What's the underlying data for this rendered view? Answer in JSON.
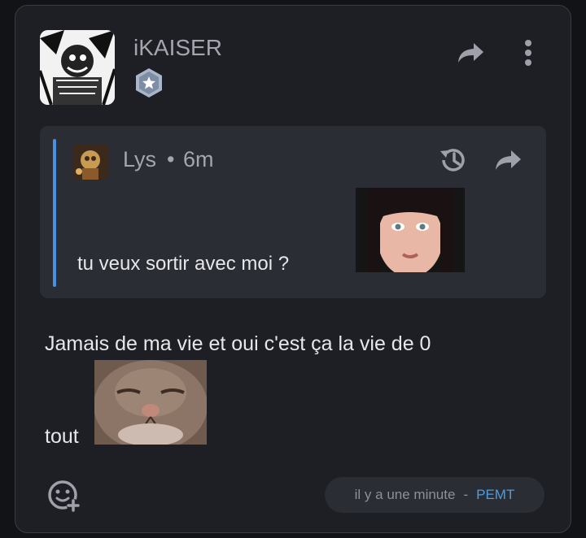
{
  "post": {
    "author": "iKAISER",
    "avatar_icon": "manga-avatar",
    "badge_icon": "star-badge-icon"
  },
  "quote": {
    "author": "Lys",
    "separator": "•",
    "time": "6m",
    "text": "tu veux sortir avec moi ?",
    "image": "girl-selfie-sticker"
  },
  "reply": {
    "line1": "Jamais de ma vie et oui c'est ça la vie de 0",
    "line2": "tout",
    "image": "cat-closed-eyes-sticker"
  },
  "footer": {
    "time": "il y a une minute",
    "dash": "-",
    "user": "PEMT"
  },
  "colors": {
    "background": "#1e1f24",
    "quote_bar": "#4a90e2",
    "link": "#4d9de0"
  }
}
